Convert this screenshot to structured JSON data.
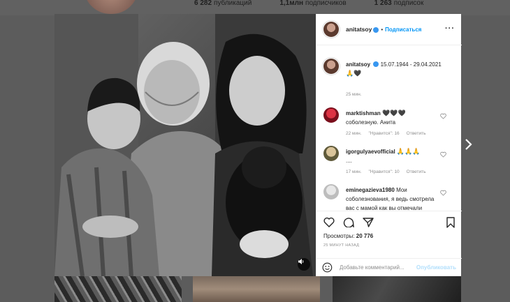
{
  "profile": {
    "stats": [
      {
        "value": "6 282",
        "label": "публикаций"
      },
      {
        "value": "1,1млн",
        "label": "подписчиков"
      },
      {
        "value": "1 263",
        "label": "подписок"
      }
    ]
  },
  "post": {
    "author": "anitatsoy",
    "follow_label": "Подписаться",
    "caption_text": "15.07.1944 - 29.04.2021",
    "caption_line2": "🙏🖤",
    "caption_time": "25 мин.",
    "views_label": "Просмотры:",
    "views_count": "20 776",
    "time_ago": "25 МИНУТ НАЗАД",
    "comment_placeholder": "Добавьте комментарий...",
    "publish_label": "Опубликовать"
  },
  "comments": [
    {
      "user": "marktishman",
      "text_top": "🖤🖤🖤",
      "text": "соболезную. Анита",
      "time": "22 мин.",
      "likes": "\"Нравится\": 16",
      "reply": "Ответить"
    },
    {
      "user": "igorgulyaevofficial",
      "text_top": "🙏🙏🙏",
      "text": "....",
      "time": "17 мин.",
      "likes": "\"Нравится\": 10",
      "reply": "Ответить"
    },
    {
      "user": "eminegazieva1980",
      "text": "Мои соболезнования, я ведь смотрела вас с мамой как вы отмечали китайский Новый год 😢😢😢я сама потеряла в"
    }
  ],
  "colors": {
    "accent": "#0095f6",
    "verified": "#3897f0",
    "text": "#262626",
    "muted": "#8e8e8e"
  }
}
